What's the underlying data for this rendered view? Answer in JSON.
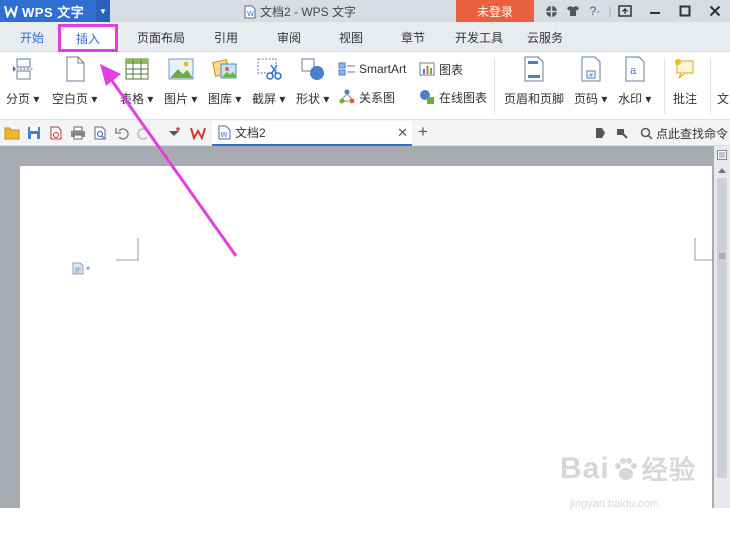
{
  "app": {
    "name": "WPS 文字",
    "doc_title": "文档2 - WPS 文字",
    "login_label": "未登录",
    "icons": [
      "skin-icon",
      "shirt-icon",
      "help-icon"
    ],
    "accent_color": "#2f6fd1",
    "login_color": "#e9603f",
    "highlight_color": "#e23fe3"
  },
  "tabs": [
    {
      "label": "开始"
    },
    {
      "label": "插入"
    },
    {
      "label": "页面布局"
    },
    {
      "label": "引用"
    },
    {
      "label": "审阅"
    },
    {
      "label": "视图"
    },
    {
      "label": "章节"
    },
    {
      "label": "开发工具"
    },
    {
      "label": "云服务"
    }
  ],
  "ribbon": {
    "page_break": "分页",
    "blank_page": "空白页",
    "table": "表格",
    "picture": "图片",
    "gallery": "图库",
    "screenshot": "截屏",
    "shapes": "形状",
    "smartart": "SmartArt",
    "chart": "图表",
    "relation_chart": "关系图",
    "online_chart": "在线图表",
    "header_footer": "页眉和页脚",
    "page_number": "页码",
    "watermark": "水印",
    "comment": "批注",
    "text_cut": "文"
  },
  "doc_tabs": {
    "current": "文档2",
    "find_command": "点此查找命令"
  },
  "watermark": {
    "brand": "Bai",
    "brand2": "经验",
    "url": "jingyan.baidu.com"
  }
}
